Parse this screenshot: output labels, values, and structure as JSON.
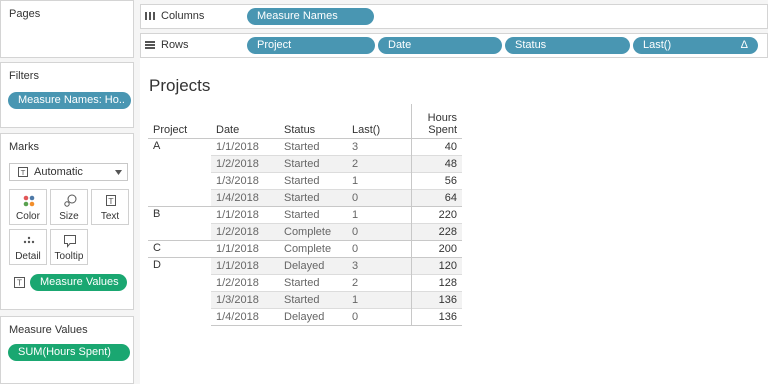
{
  "pages": {
    "title": "Pages"
  },
  "columns_shelf": {
    "label": "Columns",
    "pills": [
      "Measure Names"
    ]
  },
  "rows_shelf": {
    "label": "Rows",
    "pills": [
      "Project",
      "Date",
      "Status",
      "Last()"
    ],
    "delta_glyph": "Δ"
  },
  "filters": {
    "title": "Filters",
    "pill": "Measure Names: Ho.."
  },
  "marks": {
    "title": "Marks",
    "type_value": "Automatic",
    "buttons": {
      "color": "Color",
      "size": "Size",
      "text": "Text",
      "detail": "Detail",
      "tooltip": "Tooltip"
    },
    "text_pill": "Measure Values"
  },
  "measure_values": {
    "title": "Measure Values",
    "pill": "SUM(Hours Spent)"
  },
  "view": {
    "title": "Projects",
    "headers": {
      "project": "Project",
      "date": "Date",
      "status": "Status",
      "last": "Last()",
      "hours_line1": "Hours",
      "hours_line2": "Spent"
    },
    "groups": [
      {
        "project": "A",
        "rows": [
          {
            "date": "1/1/2018",
            "status": "Started",
            "last": "3",
            "hours": "40"
          },
          {
            "date": "1/2/2018",
            "status": "Started",
            "last": "2",
            "hours": "48"
          },
          {
            "date": "1/3/2018",
            "status": "Started",
            "last": "1",
            "hours": "56"
          },
          {
            "date": "1/4/2018",
            "status": "Started",
            "last": "0",
            "hours": "64"
          }
        ]
      },
      {
        "project": "B",
        "rows": [
          {
            "date": "1/1/2018",
            "status": "Started",
            "last": "1",
            "hours": "220"
          },
          {
            "date": "1/2/2018",
            "status": "Complete",
            "last": "0",
            "hours": "228"
          }
        ]
      },
      {
        "project": "C",
        "rows": [
          {
            "date": "1/1/2018",
            "status": "Complete",
            "last": "0",
            "hours": "200"
          }
        ]
      },
      {
        "project": "D",
        "rows": [
          {
            "date": "1/1/2018",
            "status": "Delayed",
            "last": "3",
            "hours": "120"
          },
          {
            "date": "1/2/2018",
            "status": "Started",
            "last": "2",
            "hours": "128"
          },
          {
            "date": "1/3/2018",
            "status": "Started",
            "last": "1",
            "hours": "136"
          },
          {
            "date": "1/4/2018",
            "status": "Delayed",
            "last": "0",
            "hours": "136"
          }
        ]
      }
    ]
  },
  "colors": {
    "dimension_pill": "#4996b2",
    "measure_pill": "#1aa771"
  }
}
